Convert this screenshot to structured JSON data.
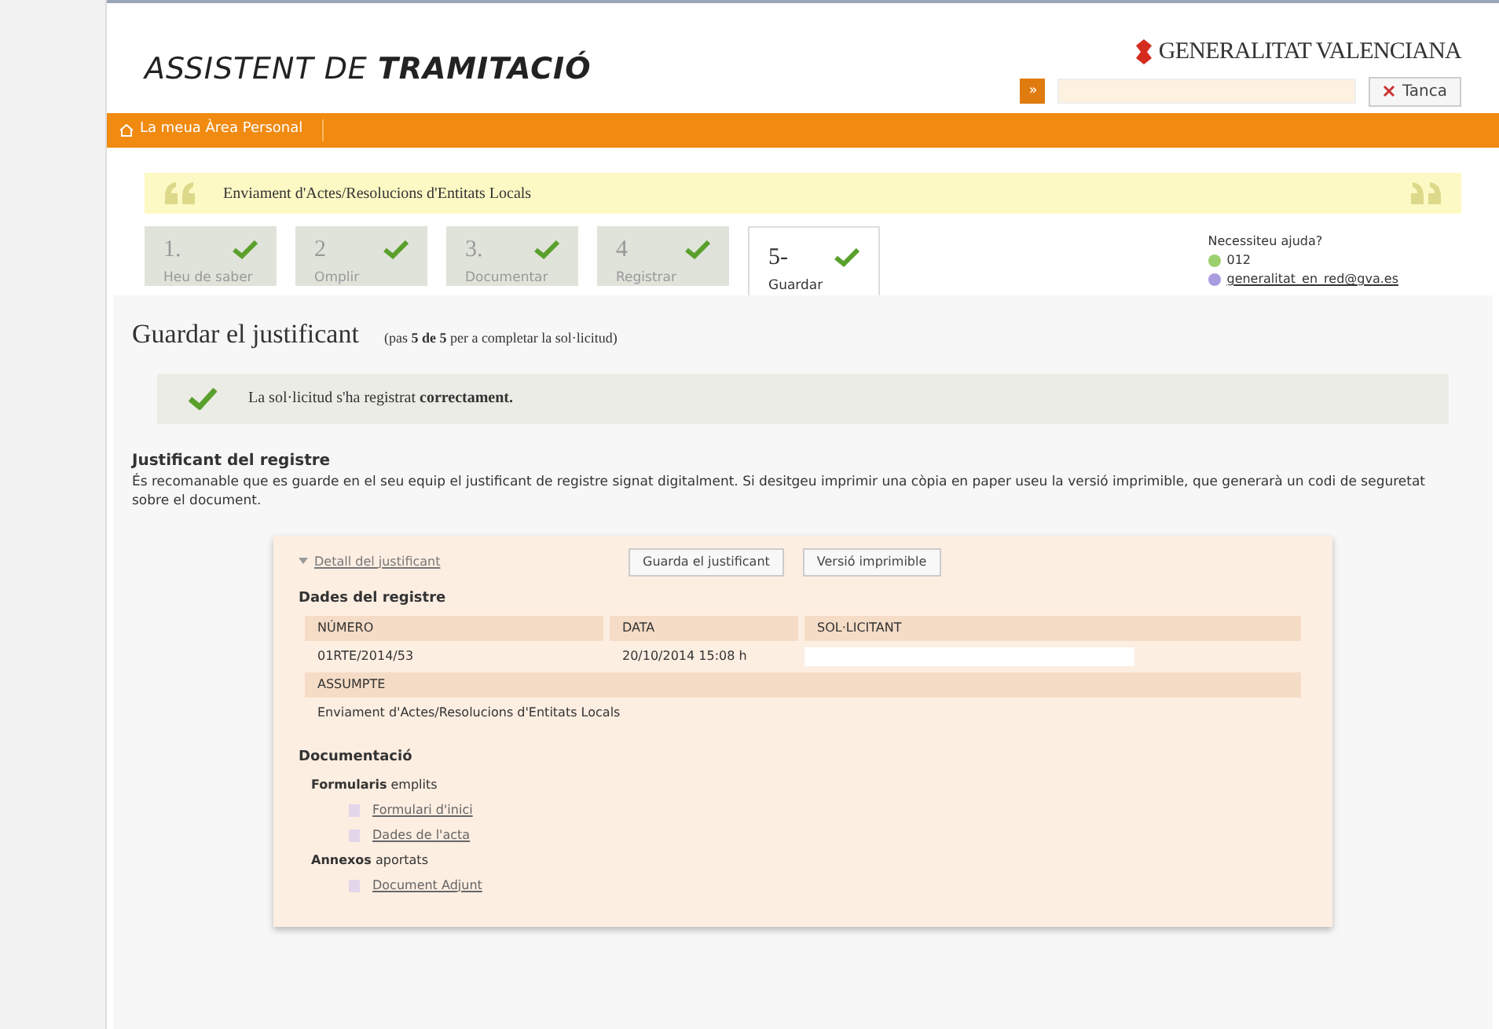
{
  "header": {
    "title_plain": "ASSISTENT DE ",
    "title_bold": "TRAMITACIÓ",
    "logo": "GENERALITAT VALENCIANA",
    "search_button": "»",
    "close_button": "Tanca"
  },
  "nav": {
    "link": "La meua Àrea Personal"
  },
  "procedure": {
    "title": "Enviament d'Actes/Resolucions d'Entitats Locals"
  },
  "steps": [
    {
      "number": "1.",
      "label": "Heu de saber",
      "done": true,
      "selected": false
    },
    {
      "number": "2",
      "label": "Omplir",
      "done": true,
      "selected": false
    },
    {
      "number": "3.",
      "label": "Documentar",
      "done": true,
      "selected": false
    },
    {
      "number": "4",
      "label": "Registrar",
      "done": true,
      "selected": false
    },
    {
      "number": "5-",
      "label": "Guardar",
      "done": true,
      "selected": true
    }
  ],
  "help": {
    "title": "Necessiteu ajuda?",
    "phone": "012",
    "email": "generalitat_en_red@gva.es"
  },
  "page": {
    "title": "Guardar el justificant",
    "progress": "(pas **5 de 5** per a completar la sol·licitud)"
  },
  "success": {
    "message": "La sol·licitud s'ha registrat **correctament.**"
  },
  "section": {
    "heading": "Justificant del registre",
    "text": "És recomanable que es guarde en el seu equip el justificant de registre signat digitalment. Si desitgeu imprimir una còpia en paper useu la versió imprimible, que generarà un codi de seguretat sobre el document."
  },
  "receipt": {
    "toggle": "Detall del justificant",
    "expanded": true,
    "buttons": [
      "Guarda el justificant",
      "Versió imprimible"
    ],
    "data_heading": "Dades del registre",
    "columns": [
      "NÚMERO",
      "DATA",
      "SOL·LICITANT"
    ],
    "row": [
      "01RTE/2014/53",
      "20/10/2014 15:08 h"
    ],
    "subject_label": "ASSUMPTE",
    "subject": "Enviament d'Actes/Resolucions d'Entitats Locals",
    "docs_heading": "Documentació",
    "groups": [
      {
        "title": "**Formularis** emplits",
        "links": [
          "Formulari d'inici",
          "Dades de l'acta"
        ]
      },
      {
        "title": "**Annexos** aportats",
        "links": [
          "Document Adjunt"
        ]
      }
    ]
  }
}
